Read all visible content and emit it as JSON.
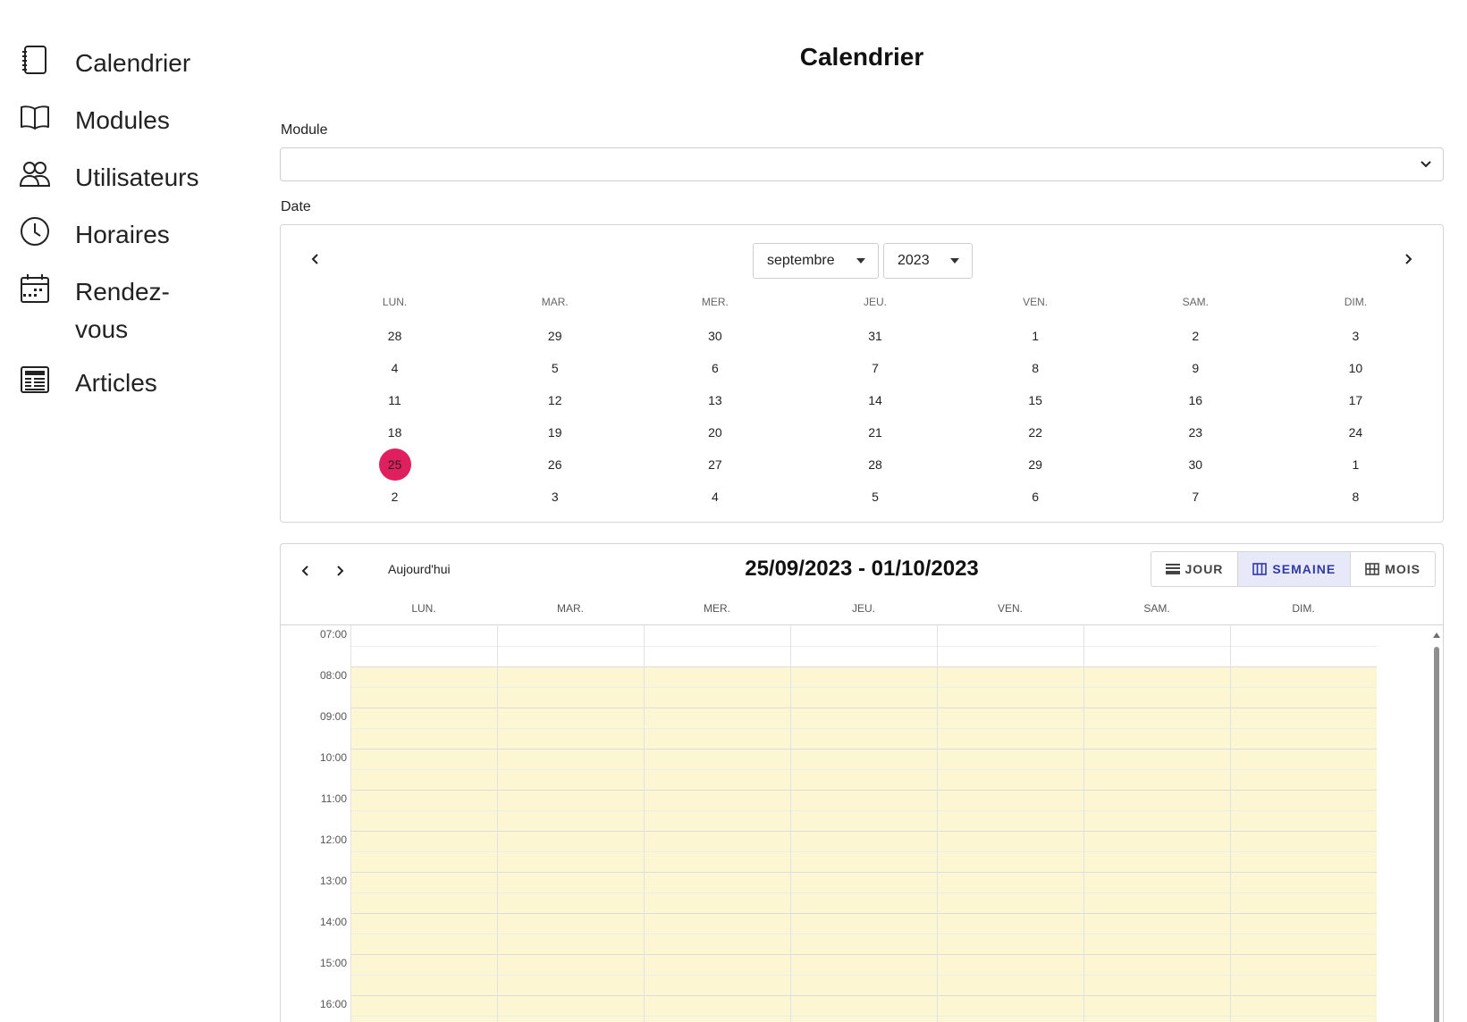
{
  "sidebar": {
    "items": [
      {
        "label": "Calendrier",
        "icon": "notebook-icon"
      },
      {
        "label": "Modules",
        "icon": "book-icon"
      },
      {
        "label": "Utilisateurs",
        "icon": "users-icon"
      },
      {
        "label": "Horaires",
        "icon": "clock-icon"
      },
      {
        "label": "Rendez-vous",
        "icon": "calendar-dots-icon"
      },
      {
        "label": "Articles",
        "icon": "newspaper-icon"
      }
    ]
  },
  "page": {
    "title": "Calendrier"
  },
  "form": {
    "module_label": "Module",
    "module_value": "",
    "date_label": "Date"
  },
  "datepicker": {
    "month": "septembre",
    "year": "2023",
    "weekdays": [
      "LUN.",
      "MAR.",
      "MER.",
      "JEU.",
      "VEN.",
      "SAM.",
      "DIM."
    ],
    "weeks": [
      [
        "28",
        "29",
        "30",
        "31",
        "1",
        "2",
        "3"
      ],
      [
        "4",
        "5",
        "6",
        "7",
        "8",
        "9",
        "10"
      ],
      [
        "11",
        "12",
        "13",
        "14",
        "15",
        "16",
        "17"
      ],
      [
        "18",
        "19",
        "20",
        "21",
        "22",
        "23",
        "24"
      ],
      [
        "25",
        "26",
        "27",
        "28",
        "29",
        "30",
        "1"
      ],
      [
        "2",
        "3",
        "4",
        "5",
        "6",
        "7",
        "8"
      ]
    ],
    "selected": "25"
  },
  "scheduler": {
    "today_label": "Aujourd'hui",
    "range_title": "25/09/2023 - 01/10/2023",
    "views": [
      {
        "label": "JOUR",
        "icon": "day-view-icon",
        "active": false
      },
      {
        "label": "SEMAINE",
        "icon": "week-view-icon",
        "active": true
      },
      {
        "label": "MOIS",
        "icon": "month-view-icon",
        "active": false
      }
    ],
    "days": [
      "LUN.",
      "MAR.",
      "MER.",
      "JEU.",
      "VEN.",
      "SAM.",
      "DIM."
    ],
    "hours": [
      "07:00",
      "08:00",
      "09:00",
      "10:00",
      "11:00",
      "12:00",
      "13:00",
      "14:00",
      "15:00",
      "16:00"
    ],
    "work_hours_color": "#fdf6d2"
  },
  "colors": {
    "accent": "#e01f5e",
    "active_view_bg": "#e8e9f8",
    "active_view_text": "#2f3aa8"
  }
}
